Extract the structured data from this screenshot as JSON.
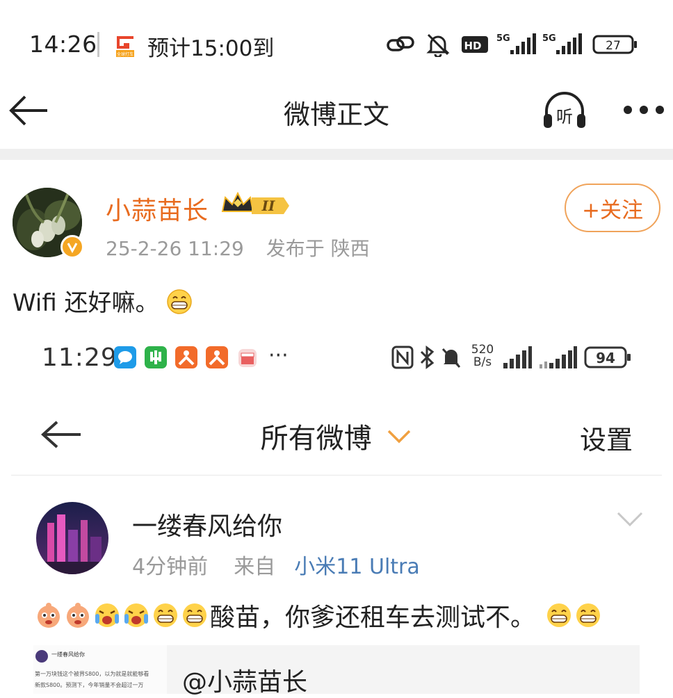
{
  "status_bar": {
    "time": "14:26",
    "app_badge_text": "全球打车",
    "notice": "预计15:00到",
    "battery": "27",
    "hd_label": "HD",
    "net1": "5G",
    "net2": "5G"
  },
  "header": {
    "title": "微博正文",
    "listen_label": "听"
  },
  "post": {
    "author": "小蒜苗长",
    "vip_level": "II",
    "date": "25-2-26 11:29",
    "location": "发布于 陕西",
    "follow_label": "+关注",
    "text": "Wifi 还好嘛。"
  },
  "embedded": {
    "time": "11:29",
    "more_dots": "···",
    "speed": "520",
    "speed_unit": "B/s",
    "battery": "94",
    "title": "所有微博",
    "settings": "设置",
    "user": "一缕春风给你",
    "time_ago": "4分钟前",
    "from_label": "来自",
    "device": "小米11 Ultra",
    "text": "酸苗，你爹还租车去测试不。",
    "quote_mention": "@小蒜苗长",
    "quote_header": "一缕春风给你",
    "quote_lines": [
      "第一万块钱这个被界S800，以为就是就能够看",
      "新款S800。预测下，今年销量不会超过一万"
    ]
  },
  "colors": {
    "accent_orange": "#e86b1f",
    "follow_border": "#f0a35a",
    "link_blue": "#4a7cb5",
    "gray_text": "#9a9a9a"
  }
}
